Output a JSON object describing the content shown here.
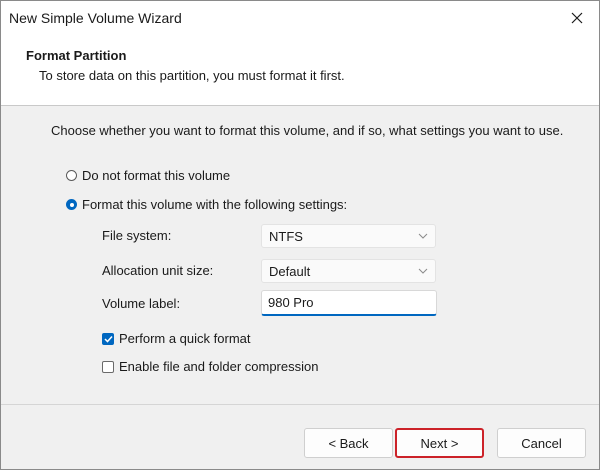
{
  "window": {
    "title": "New Simple Volume Wizard"
  },
  "header": {
    "title": "Format Partition",
    "subtitle": "To store data on this partition, you must format it first."
  },
  "main": {
    "instruction": "Choose whether you want to format this volume, and if so, what settings you want to use.",
    "options": {
      "no_format": {
        "label": "Do not format this volume",
        "selected": false
      },
      "format": {
        "label": "Format this volume with the following settings:",
        "selected": true
      }
    },
    "settings": {
      "file_system": {
        "label": "File system:",
        "value": "NTFS"
      },
      "allocation_unit_size": {
        "label": "Allocation unit size:",
        "value": "Default"
      },
      "volume_label": {
        "label": "Volume label:",
        "value": "980 Pro"
      }
    },
    "checkboxes": {
      "quick_format": {
        "label": "Perform a quick format",
        "checked": true
      },
      "compression": {
        "label": "Enable file and folder compression",
        "checked": false
      }
    }
  },
  "buttons": {
    "back": "< Back",
    "next": "Next >",
    "cancel": "Cancel"
  },
  "icons": {
    "close": "close-icon",
    "chevron": "chevron-down-icon",
    "check": "checkmark-icon"
  },
  "colors": {
    "accent": "#0067c0",
    "highlight": "#cc2229",
    "panel": "#f0f0f0"
  }
}
